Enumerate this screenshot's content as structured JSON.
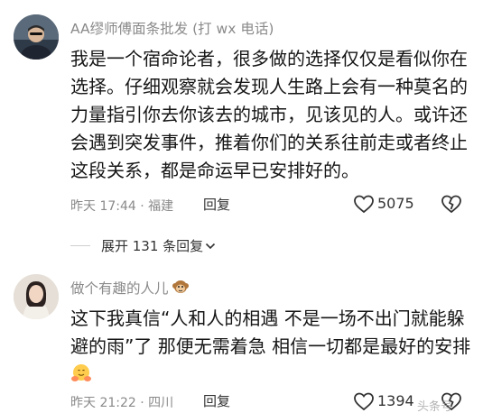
{
  "comments": [
    {
      "username": "AA缪师傅面条批发 (打 wx 电话)",
      "lines": [
        "我是一个宿命论者，很多做的选择仅仅是看似你在",
        "选择。仔细观察就会发现人生路上会有一种莫名的",
        "力量指引你去你该去的城市，见该见的人。或许还",
        "会遇到突发事件，推着你们的关系往前走或者终止",
        "这段关系，都是命运早已安排好的。"
      ],
      "meta": "昨天 17:44 · 福建",
      "reply_label": "回复",
      "like_count": "5075"
    },
    {
      "username": "做个有趣的人儿",
      "lines": [
        "这下我真信“人和人的相遇 不是一场不出门就能躲",
        "避的雨”了 那便无需着急 相信一切都是最好的安排"
      ],
      "meta": "昨天 21:22 · 四川",
      "reply_label": "回复",
      "like_count": "1394"
    }
  ],
  "expand_replies": "展开 131 条回复",
  "watermark": "头条号"
}
